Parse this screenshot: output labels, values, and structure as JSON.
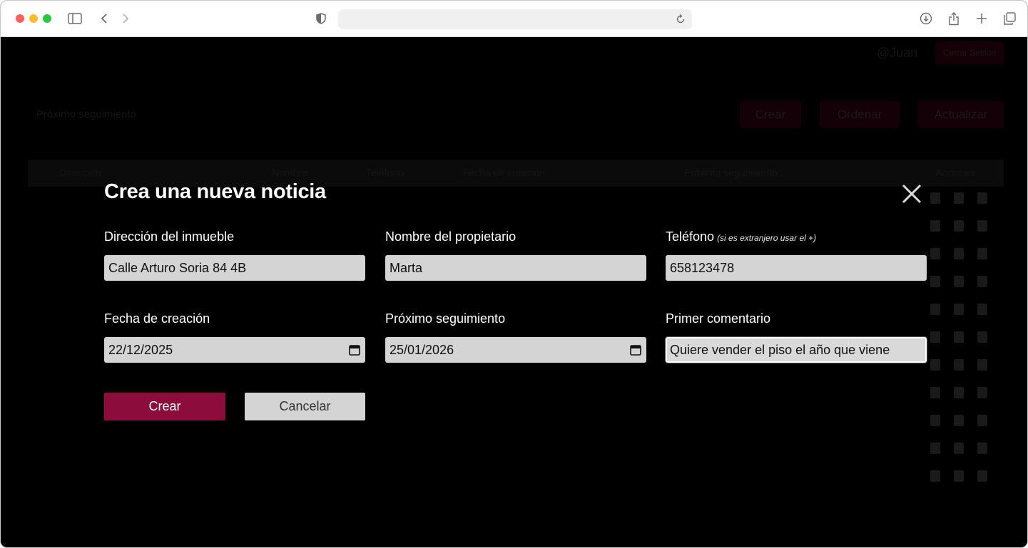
{
  "app": {
    "header_user": "@Juan",
    "header_logout": "Cerrar Sesion",
    "filter_label": "Próximo seguimiento",
    "toolbar": {
      "create": "Crear",
      "sort": "Ordenar",
      "refresh": "Actualizar"
    },
    "table_headers": [
      "Dirección",
      "Nombre",
      "Teléfono",
      "Fecha de creación",
      "Próximo seguimiento",
      "Acciones"
    ]
  },
  "modal": {
    "title": "Crea una nueva noticia",
    "close_icon": "close-icon",
    "fields": {
      "address": {
        "label": "Dirección del inmueble",
        "value": "Calle Arturo Soria 84 4B"
      },
      "owner": {
        "label": "Nombre del propietario",
        "value": "Marta"
      },
      "phone": {
        "label": "Teléfono",
        "hint": "(si es extranjero usar el +)",
        "value": "658123478"
      },
      "created": {
        "label": "Fecha de creación",
        "value": "22/12/2025"
      },
      "next": {
        "label": "Próximo seguimiento",
        "value": "25/01/2026"
      },
      "comment": {
        "label": "Primer comentario",
        "value": "Quiere vender el piso el año que viene"
      }
    },
    "buttons": {
      "create": "Crear",
      "cancel": "Cancelar"
    },
    "colors": {
      "primary": "#8c0d3c",
      "overlay": "#000000"
    }
  }
}
